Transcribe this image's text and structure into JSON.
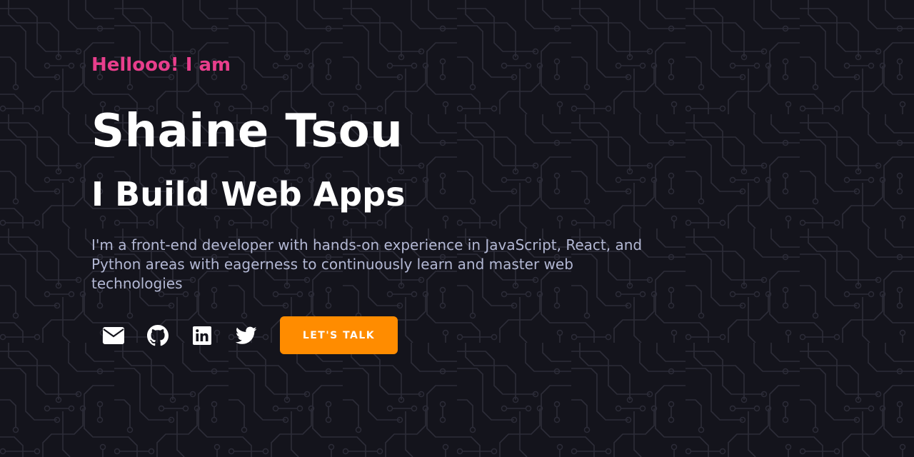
{
  "hero": {
    "greeting": "Hellooo! I am",
    "name": "Shaine Tsou",
    "tagline": "I Build Web Apps",
    "bio": "I'm a front-end developer with hands-on experience in JavaScript, React, and Python areas with eagerness to continuously learn and master web technologies",
    "cta_label": "LET'S TALK"
  },
  "social": [
    {
      "icon": "envelope-icon"
    },
    {
      "icon": "github-icon"
    },
    {
      "icon": "linkedin-icon"
    },
    {
      "icon": "twitter-icon"
    }
  ],
  "colors": {
    "background": "#14141c",
    "circuit_lines": "#2c2c38",
    "greeting": "#e83e8c",
    "heading": "#ffffff",
    "bio": "#b3b8d4",
    "accent": "#ff8c00"
  }
}
